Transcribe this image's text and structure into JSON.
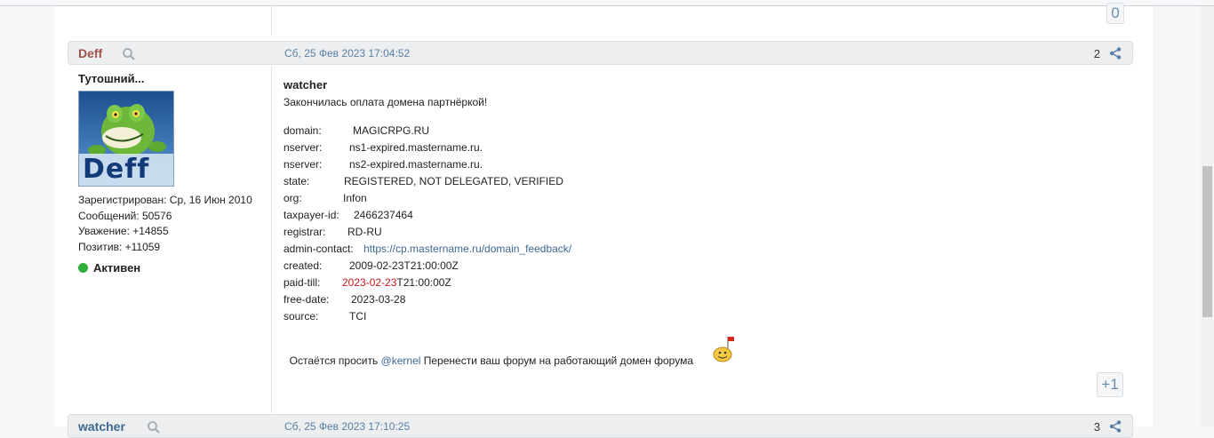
{
  "previous_post": {
    "vote_count": "0"
  },
  "post": {
    "author": "Deff",
    "date": "Сб, 25 Фев 2023 17:04:52",
    "number": "2",
    "user_title": "Тутошний...",
    "avatar_text": "Deff",
    "stats": {
      "registered": "Зарегистрирован: Ср, 16 Июн 2010",
      "messages": "Сообщений: 50576",
      "respect": "Уважение: +14855",
      "positive": "Позитив: +11059"
    },
    "status": "Активен",
    "status_color": "#2fae3a",
    "quote_author": "watcher",
    "intro": "Закончилась оплата домена партнёркой!",
    "whois": [
      {
        "key": "domain:",
        "value": "MAGICRPG.RU"
      },
      {
        "key": "nserver:",
        "value": "ns1-expired.mastername.ru."
      },
      {
        "key": "nserver:",
        "value": "ns2-expired.mastername.ru."
      },
      {
        "key": "state:",
        "value": "REGISTERED, NOT DELEGATED, VERIFIED"
      },
      {
        "key": "org:",
        "value": "Infon"
      },
      {
        "key": "taxpayer-id:",
        "value": "2466237464"
      },
      {
        "key": "registrar:",
        "value": "RD-RU"
      },
      {
        "key": "admin-contact:",
        "value": "https://cp.mastername.ru/domain_feedback/"
      },
      {
        "key": "created:",
        "value": "2009-02-23T21:00:00Z"
      },
      {
        "key": "paid-till:",
        "value_red": "2023-02-23",
        "value_rest": "T21:00:00Z"
      },
      {
        "key": "free-date:",
        "value": "2023-03-28"
      },
      {
        "key": "source:",
        "value": "TCI"
      }
    ],
    "outro_prefix": "Остаётся просить ",
    "outro_mention": "@kernel",
    "outro_suffix": " Перенести ваш форум на работающий домен форума",
    "vote_label": "+1",
    "accent_color": "#3d6891",
    "author_color": "#a0524b"
  },
  "next_post": {
    "author": "watcher",
    "date": "Сб, 25 Фев 2023 17:10:25",
    "number": "3"
  }
}
